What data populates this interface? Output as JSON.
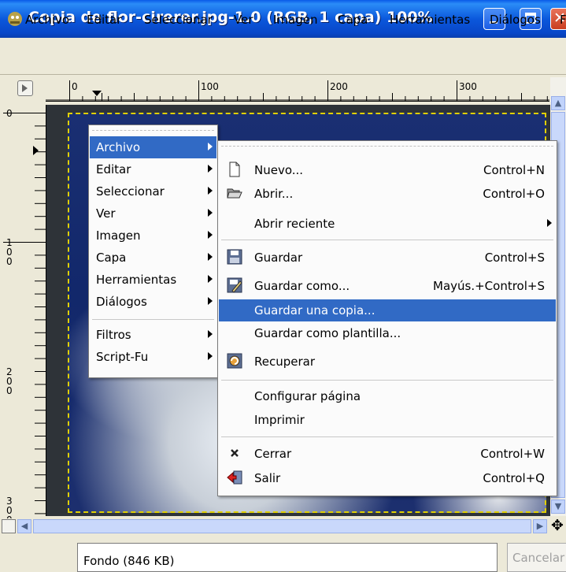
{
  "window": {
    "title": "Copia de flor-cirerer.jpg-1.0 (RGB, 1 capa) 100%"
  },
  "menubar": {
    "items": [
      "Archivo",
      "Editar",
      "Seleccionar",
      "Ver",
      "Imagen",
      "Capa",
      "Herramientas",
      "Diálogos",
      "F"
    ]
  },
  "ruler": {
    "h_labels": [
      "0",
      "100",
      "200",
      "300"
    ],
    "v_labels": [
      "0",
      "100",
      "200",
      "300"
    ]
  },
  "context_menu": {
    "items": [
      {
        "label": "Archivo",
        "highlighted": true
      },
      {
        "label": "Editar"
      },
      {
        "label": "Seleccionar"
      },
      {
        "label": "Ver"
      },
      {
        "label": "Imagen"
      },
      {
        "label": "Capa"
      },
      {
        "label": "Herramientas"
      },
      {
        "label": "Diálogos"
      },
      {
        "label": "Filtros"
      },
      {
        "label": "Script-Fu"
      }
    ]
  },
  "archivo_submenu": {
    "items": [
      {
        "label": "Nuevo...",
        "accel": "Control+N",
        "icon": "new-file-icon"
      },
      {
        "label": "Abrir...",
        "accel": "Control+O",
        "icon": "folder-open-icon"
      },
      {
        "label": "Abrir reciente",
        "accel": ""
      },
      {
        "label": "Guardar",
        "accel": "Control+S",
        "icon": "floppy-save-icon"
      },
      {
        "label": "Guardar como...",
        "accel": "Mayús.+Control+S",
        "icon": "save-as-icon"
      },
      {
        "label": "Guardar una copia...",
        "accel": "",
        "highlighted": true
      },
      {
        "label": "Guardar como plantilla...",
        "accel": ""
      },
      {
        "label": "Recuperar",
        "accel": "",
        "icon": "revert-icon"
      },
      {
        "label": "Configurar página",
        "accel": ""
      },
      {
        "label": "Imprimir",
        "accel": ""
      },
      {
        "label": "Cerrar",
        "accel": "Control+W",
        "icon": "close-x-icon"
      },
      {
        "label": "Salir",
        "accel": "Control+Q",
        "icon": "quit-icon"
      }
    ]
  },
  "status": {
    "layer": "Fondo (846 KB)",
    "cancel": "Cancelar"
  },
  "colors": {
    "titlebar": "#0b58dc",
    "highlight": "#316ac5",
    "selection_marquee": "#e0d000"
  }
}
